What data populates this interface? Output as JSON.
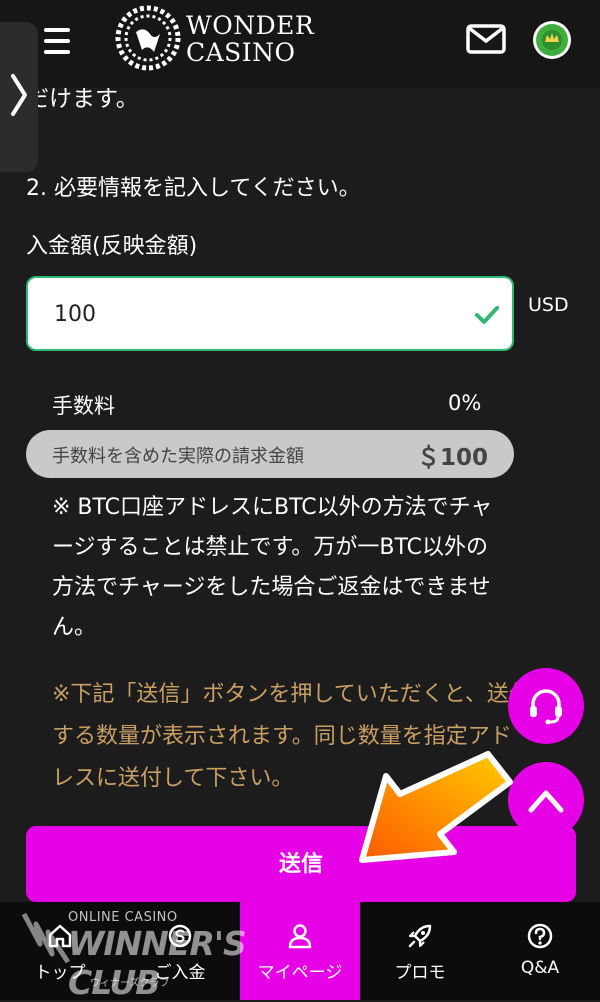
{
  "header": {
    "logo_line1": "WONDER",
    "logo_line2": "CASINO"
  },
  "content": {
    "partial_line": "だけます。",
    "step_text": "2. 必要情報を記入してください。",
    "amount_label": "入金額(反映金額)",
    "amount_value": "100",
    "currency": "USD",
    "fee_label": "手数料",
    "fee_value": "0%",
    "total_label": "手数料を含めた実際の請求金額",
    "total_value": "＄100",
    "notice_white": "※ BTC口座アドレスにBTC以外の方法でチャージすることは禁止です。万が一BTC以外の方法でチャージをした場合ご返金はできません。",
    "notice_gold": "※下記「送信」ボタンを押していただくと、送付する数量が表示されます。同じ数量を指定アドレスに送付して下さい。",
    "submit_label": "送信"
  },
  "nav": {
    "items": [
      {
        "label": "トップ",
        "icon": "home-icon"
      },
      {
        "label": "ご入金",
        "icon": "deposit-icon"
      },
      {
        "label": "マイページ",
        "icon": "user-icon"
      },
      {
        "label": "プロモ",
        "icon": "rocket-icon"
      },
      {
        "label": "Q&A",
        "icon": "question-icon"
      }
    ],
    "active_index": 2
  },
  "watermark": {
    "top": "ONLINE CASINO",
    "main": "WINNER'S CLUB",
    "sub": "ウィナーズクラブ"
  },
  "colors": {
    "accent": "#e600e6",
    "background": "#1c1c1c",
    "header": "#161616",
    "gold_text": "#c9a063",
    "success": "#2eb872",
    "arrow_start": "#ffcc00",
    "arrow_end": "#ff5a00"
  }
}
